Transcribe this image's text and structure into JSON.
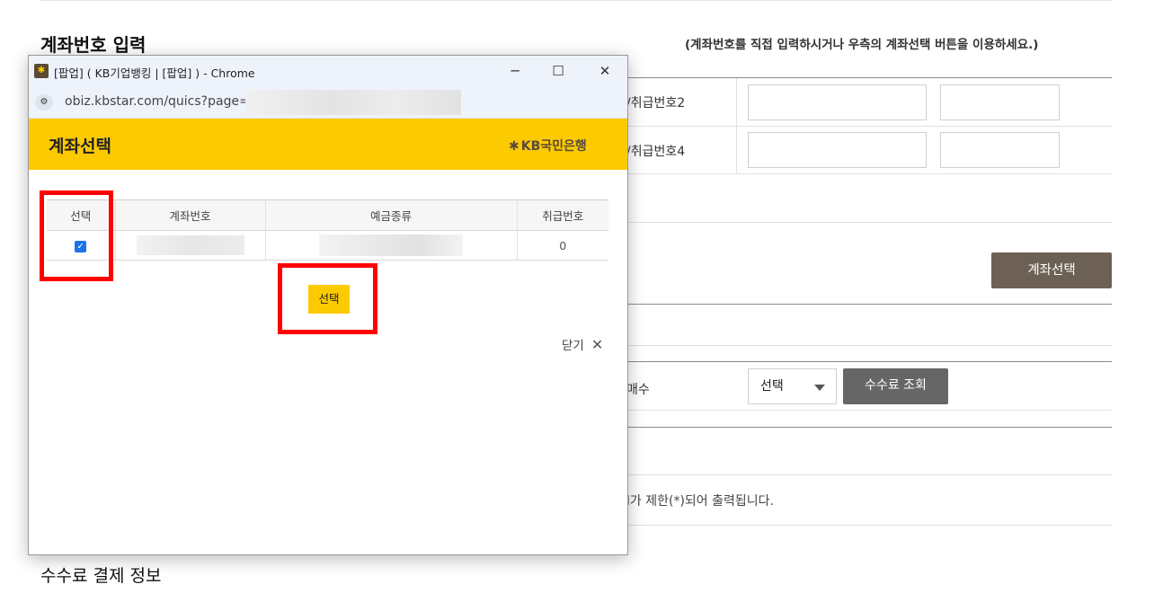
{
  "page": {
    "section_account_title": "계좌번호 입력",
    "account_hint": "(계좌번호를 직접 입력하시거나 우측의 계좌선택 버튼을 이용하세요.)",
    "field_label_2": "/취급번호2",
    "field_label_4": "/취급번호4",
    "account_select_button": "계좌선택",
    "count_label": "매수",
    "count_select_value": "선택",
    "fee_lookup_button": "수수료 조회",
    "restriction_note": "l가 제한(*)되어 출력됩니다.",
    "section_fee_title": "수수료 결제 정보"
  },
  "popup": {
    "window_title": "[팝업] ( KB기업뱅킹 | [팝업] ) - Chrome",
    "window_controls": {
      "minimize": "─",
      "maximize": "☐",
      "close": "✕"
    },
    "url": "obiz.kbstar.com/quics?page=",
    "url_icon": "site-settings-icon",
    "header_title": "계좌선택",
    "brand_logo": "KB국민은행",
    "table": {
      "headers": [
        "선택",
        "계좌번호",
        "예금종류",
        "취급번호"
      ],
      "rows": [
        {
          "selected": true,
          "account_number": "",
          "deposit_type": "",
          "handling_number": "0"
        }
      ]
    },
    "select_button": "선택",
    "close_label": "닫기",
    "close_icon": "close-icon"
  },
  "colors": {
    "kb_yellow": "#fcca00",
    "kb_brown": "#6d6155",
    "highlight_red": "#ff0000",
    "checkbox_blue": "#1a73e8"
  }
}
